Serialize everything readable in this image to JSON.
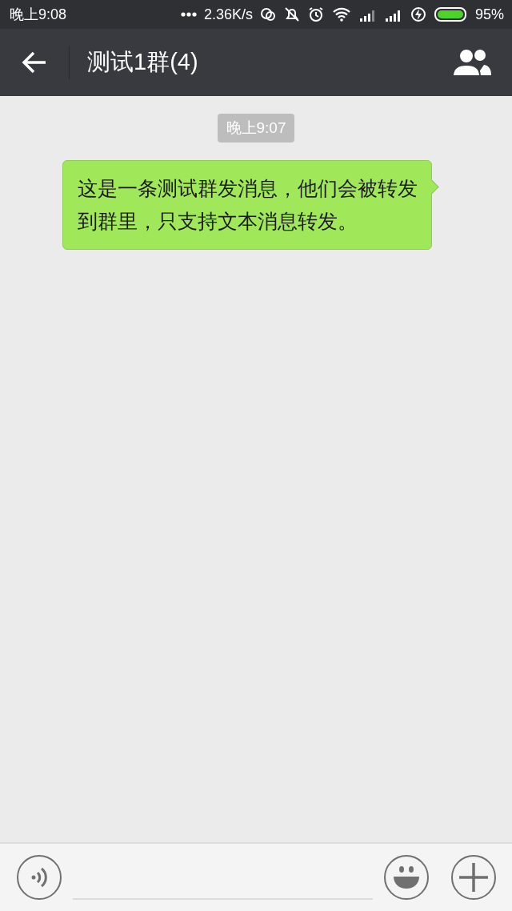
{
  "status_bar": {
    "time": "晚上9:08",
    "network_speed": "2.36K/s",
    "battery": "95%"
  },
  "header": {
    "title": "测试1群(4)"
  },
  "chat": {
    "timestamp": "晚上9:07",
    "messages": [
      {
        "text": "这是一条测试群发消息，他们会被转发到群里，只支持文本消息转发。",
        "outgoing": true
      }
    ]
  }
}
